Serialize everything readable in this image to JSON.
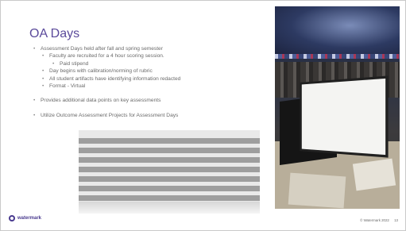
{
  "slide": {
    "title": "OA Days",
    "bullets": [
      {
        "level": 1,
        "text": "Assessment Days held after fall and spring semester"
      },
      {
        "level": 2,
        "text": "Faculty are recruited for a 4 hour scoring session."
      },
      {
        "level": 3,
        "text": "Paid stipend"
      },
      {
        "level": 2,
        "text": "Day begins with calibration/norming of rubric"
      },
      {
        "level": 2,
        "text": "All student artifacts have identifying information redacted"
      },
      {
        "level": 2,
        "text": "Format - Virtual"
      },
      {
        "level": 1,
        "text": "Provides additional data points on key assessments"
      },
      {
        "level": 1,
        "text": "Utilize Outcome Assessment Projects for Assessment Days"
      }
    ],
    "logo_text": "watermark",
    "footer": {
      "copyright": "© Watermark 2022",
      "page_number": "13"
    },
    "colors": {
      "title": "#5b4a9b",
      "text": "#6a6a6a",
      "brand": "#4a3b8f"
    }
  }
}
